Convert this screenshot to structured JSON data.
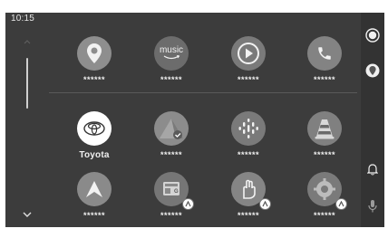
{
  "status_bar": {
    "time": "10:15"
  },
  "apps": [
    {
      "name": "maps",
      "label": "******",
      "icon": "map-pin-icon",
      "color": "#8a8a8a"
    },
    {
      "name": "amazon-music",
      "label": "******",
      "icon": "amazon-music-icon",
      "color": "#707070",
      "icon_text": "music"
    },
    {
      "name": "play-media",
      "label": "******",
      "icon": "play-icon",
      "color": "#7a7a7a"
    },
    {
      "name": "phone",
      "label": "******",
      "icon": "phone-icon",
      "color": "#808080"
    },
    {
      "name": "toyota",
      "label": "Toyota",
      "icon": "toyota-logo-icon",
      "color": "#ffffff"
    },
    {
      "name": "app-checkmark",
      "label": "******",
      "icon": "mountain-check-icon",
      "color": "#8a8a8a"
    },
    {
      "name": "podcast",
      "label": "******",
      "icon": "podcast-icon",
      "color": "#7a7a7a"
    },
    {
      "name": "vlc",
      "label": "******",
      "icon": "traffic-cone-icon",
      "color": "#7e7e7e"
    },
    {
      "name": "navigation",
      "label": "******",
      "icon": "navigation-arrow-icon",
      "color": "#8a8a8a"
    },
    {
      "name": "news-app",
      "label": "******",
      "icon": "news-icon",
      "color": "#777777"
    },
    {
      "name": "hand-app",
      "label": "******",
      "icon": "hand-icon",
      "color": "#858585"
    },
    {
      "name": "gear-app",
      "label": "******",
      "icon": "gear-app-icon",
      "color": "#7a7a7a"
    }
  ],
  "right_rail": [
    {
      "name": "record-icon"
    },
    {
      "name": "map-pin-icon"
    },
    {
      "name": "bell-icon"
    },
    {
      "name": "microphone-icon"
    }
  ]
}
